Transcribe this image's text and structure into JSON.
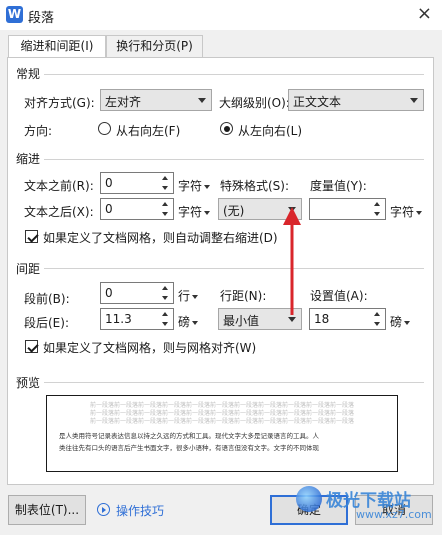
{
  "window": {
    "app_icon_letter": "W",
    "title": "段落",
    "close_symbol": "×"
  },
  "tabs": [
    {
      "label": "缩进和间距(I)",
      "active": true
    },
    {
      "label": "换行和分页(P)",
      "active": false
    }
  ],
  "general": {
    "section_title": "常规",
    "alignment_label": "对齐方式(G):",
    "alignment_value": "左对齐",
    "outline_label": "大纲级别(O):",
    "outline_value": "正文文本",
    "direction_label": "方向:",
    "rtl_label": "从右向左(F)",
    "ltr_label": "从左向右(L)",
    "selected_direction": "ltr"
  },
  "indent": {
    "section_title": "缩进",
    "before_label": "文本之前(R):",
    "before_value": "0",
    "before_unit": "字符",
    "special_label": "特殊格式(S):",
    "special_value": "(无)",
    "measure_label": "度量值(Y):",
    "measure_value": "",
    "measure_unit": "字符",
    "after_label": "文本之后(X):",
    "after_value": "0",
    "after_unit": "字符",
    "auto_adjust_label": "如果定义了文档网格，则自动调整右缩进(D)",
    "auto_adjust_checked": true
  },
  "spacing": {
    "section_title": "间距",
    "before_label": "段前(B):",
    "before_value": "0",
    "before_unit": "行",
    "line_spacing_label": "行距(N):",
    "line_spacing_value": "最小值",
    "setting_label": "设置值(A):",
    "setting_value": "18",
    "setting_unit": "磅",
    "after_label": "段后(E):",
    "after_value": "11.3",
    "after_unit": "磅",
    "snap_grid_label": "如果定义了文档网格，则与网格对齐(W)",
    "snap_grid_checked": true
  },
  "preview": {
    "section_title": "预览",
    "gray_line": "前一段落前一段落前一段落前一段落前一段落前一段落前一段落前一段落前一段落前一段落前一段落",
    "sample_line_1": "是人类用符号记录表达信息以持之久远的方式和工具。现代文字大多是记录语言的工具。人",
    "sample_line_2": "类往往先有口头的语言后产生书面文字，很多小语种，有语言但没有文字。文字的不同体现"
  },
  "footer": {
    "tabs_button": "制表位(T)...",
    "tips_link": "操作技巧",
    "ok_button": "确定",
    "cancel_button": "取消"
  },
  "watermark": {
    "text": "极光下载站",
    "url": "www.xz7.com"
  },
  "colors": {
    "accent": "#2f6fd6",
    "annotation_arrow": "#d9262b"
  }
}
